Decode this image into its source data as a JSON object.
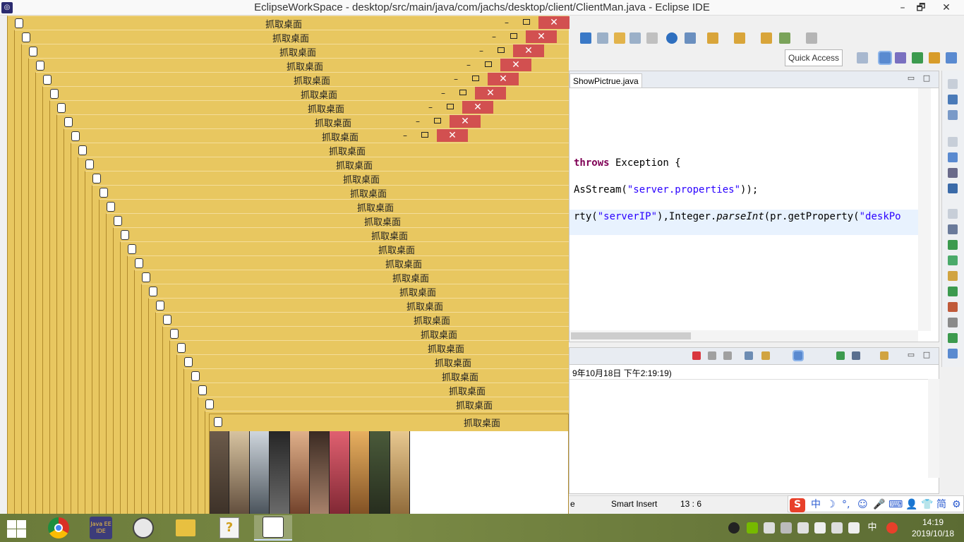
{
  "eclipse": {
    "window_title": "EclipseWorkSpace - desktop/src/main/java/com/jachs/desktop/client/ClientMan.java - Eclipse IDE",
    "minimize": "–",
    "maximize": "🗗",
    "close": "✕",
    "quick_access": "Quick Access",
    "editor_tab": "ShowPictrue.java",
    "code": {
      "line1_kw": "throws",
      "line1_rest": " Exception {",
      "line2_pre": "AsStream(",
      "line2_str": "\"server.properties\"",
      "line2_post": "));",
      "line3_pre": "rty(",
      "line3_str1": "\"serverIP\"",
      "line3_mid": "),Integer.",
      "line3_it": "parseInt",
      "line3_post": "(pr.getProperty(",
      "line3_str2": "\"deskPo"
    },
    "console_header": "9年10月18日 下午2:19:19)",
    "status": {
      "insert_mode": "Smart Insert",
      "position": "13 : 6",
      "left_cell": "e"
    }
  },
  "capture_windows": {
    "title": "抓取桌面",
    "close": "✕",
    "count": 29
  },
  "taskbar": {
    "apps": [
      {
        "name": "chrome",
        "label": ""
      },
      {
        "name": "eclipse",
        "label": "Java EE IDE"
      },
      {
        "name": "one-piece",
        "label": ""
      },
      {
        "name": "file-explorer",
        "label": ""
      },
      {
        "name": "help-doc",
        "label": ""
      },
      {
        "name": "capture-app",
        "label": ""
      }
    ],
    "ime": {
      "lang": "中",
      "width_mode": "☽",
      "punct": "°,",
      "emoji": "☺",
      "voice": "🎤",
      "keyboard": "⌨",
      "user": "👤",
      "skin": "👕",
      "trad": "简",
      "tools": "⚙"
    },
    "tray_lang": "中",
    "clock_time": "14:19",
    "clock_date": "2019/10/18"
  }
}
